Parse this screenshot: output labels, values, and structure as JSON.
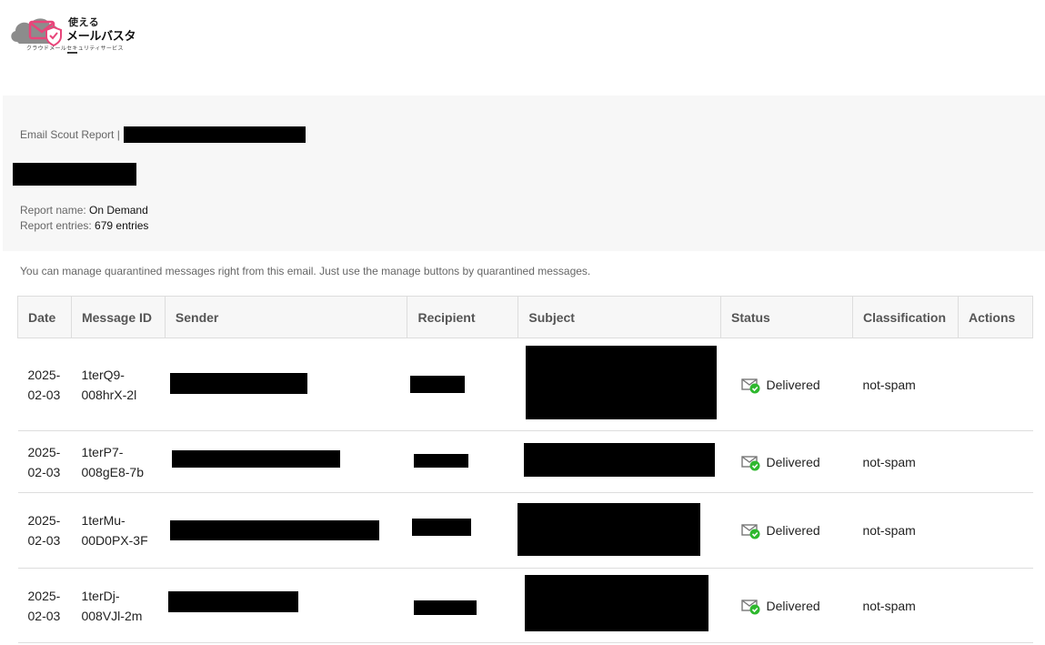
{
  "logo": {
    "line1": "使える",
    "line2": "メールバスター",
    "line3": "クラウドメールセキュリティサービス"
  },
  "report": {
    "title_prefix": "Email Scout Report |",
    "name_label": "Report name:",
    "name_value": "On Demand",
    "entries_label": "Report entries:",
    "entries_value": "679 entries"
  },
  "notice": "You can manage quarantined messages right from this email. Just use the manage buttons by quarantined messages.",
  "table": {
    "headers": [
      "Date",
      "Message ID",
      "Sender",
      "Recipient",
      "Subject",
      "Status",
      "Classification",
      "Actions"
    ],
    "rows": [
      {
        "date": "2025-\n02-03",
        "message_id": "1terQ9-\n008hrX-2l",
        "status": "Delivered",
        "classification": "not-spam"
      },
      {
        "date": "2025-\n02-03",
        "message_id": "1terP7-\n008gE8-7b",
        "status": "Delivered",
        "classification": "not-spam"
      },
      {
        "date": "2025-\n02-03",
        "message_id": "1terMu-\n00D0PX-3F",
        "status": "Delivered",
        "classification": "not-spam"
      },
      {
        "date": "2025-\n02-03",
        "message_id": "1terDj-\n008VJl-2m",
        "status": "Delivered",
        "classification": "not-spam"
      }
    ]
  },
  "colors": {
    "status_check": "#2eb82e",
    "logo_cloud": "#8c8c8c",
    "logo_accent": "#e8457a"
  },
  "icons": {
    "status": "envelope-check-icon"
  }
}
